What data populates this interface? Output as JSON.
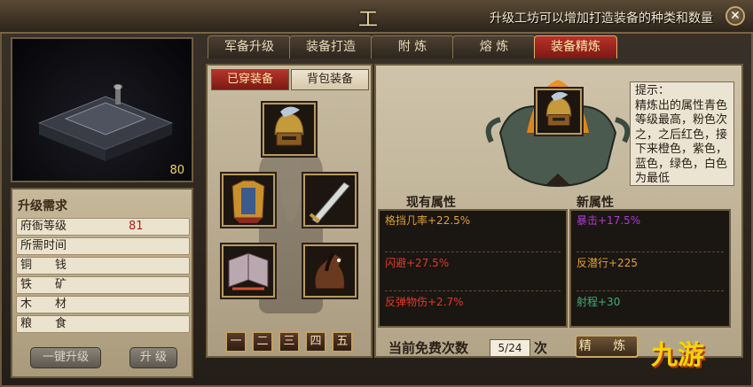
{
  "window": {
    "title": "工 坊",
    "top_hint": "升级工坊可以增加打造装备的种类和数量"
  },
  "tabs": [
    {
      "label": "军备升级"
    },
    {
      "label": "装备打造"
    },
    {
      "label": "附 炼"
    },
    {
      "label": "熔 炼"
    },
    {
      "label": "装备精炼"
    }
  ],
  "preview": {
    "level": "80"
  },
  "requirements": {
    "title": "升级需求",
    "rows": [
      {
        "label": "府衙等级",
        "value": "81"
      },
      {
        "label": "所需时间",
        "value": ""
      },
      {
        "label": "铜　　钱",
        "value": ""
      },
      {
        "label": "铁　　矿",
        "value": ""
      },
      {
        "label": "木　　材",
        "value": ""
      },
      {
        "label": "粮　　食",
        "value": ""
      }
    ],
    "quick_upgrade": "一键升级",
    "upgrade": "升 级"
  },
  "equipment": {
    "tab_worn": "已穿装备",
    "tab_bag": "背包装备",
    "pages": [
      "一",
      "二",
      "三",
      "四",
      "五"
    ]
  },
  "refine": {
    "tip": "提示：\n精炼出的属性青色等级最高，粉色次之，之后红色，接下来橙色，紫色，蓝色，绿色，白色为最低",
    "current_title": "现有属性",
    "new_title": "新属性",
    "current_attrs": [
      {
        "text": "格挡几率+22.5%",
        "color": "#e0a030"
      },
      {
        "text": "闪避+27.5%",
        "color": "#e03a2a"
      },
      {
        "text": "反弹物伤+2.7%",
        "color": "#e03a2a"
      }
    ],
    "new_attrs": [
      {
        "text": "暴击+17.5%",
        "color": "#b03ad0"
      },
      {
        "text": "反潜行+225",
        "color": "#e0a030"
      },
      {
        "text": "射程+30",
        "color": "#3fb070"
      }
    ],
    "free_label": "当前免费次数",
    "free_count": "5/24",
    "free_unit": "次",
    "refine_button": "精 炼"
  },
  "watermark": "九游"
}
